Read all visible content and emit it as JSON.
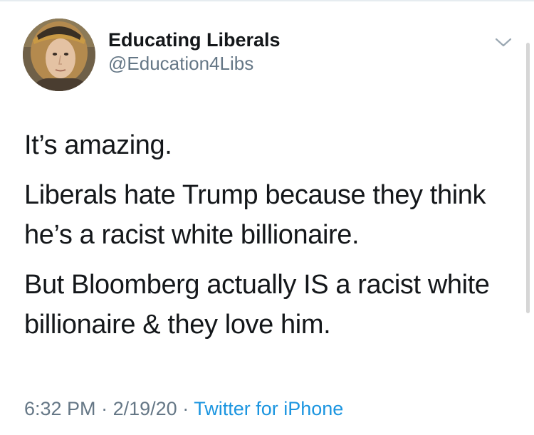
{
  "user": {
    "display_name": "Educating Liberals",
    "handle": "@Education4Libs",
    "avatar_icon": "profile-photo"
  },
  "tweet": {
    "paragraphs": [
      "It’s amazing.",
      "Liberals hate Trump because they think he’s a racist white billionaire.",
      "But Bloomberg actually IS a racist white billionaire & they love him."
    ],
    "time": "6:32 PM",
    "separator": "·",
    "date": "2/19/20",
    "source": "Twitter for iPhone"
  },
  "icons": {
    "menu": "chevron-down-icon"
  },
  "colors": {
    "text": "#14171a",
    "secondary": "#657786",
    "link": "#1b95e0"
  }
}
